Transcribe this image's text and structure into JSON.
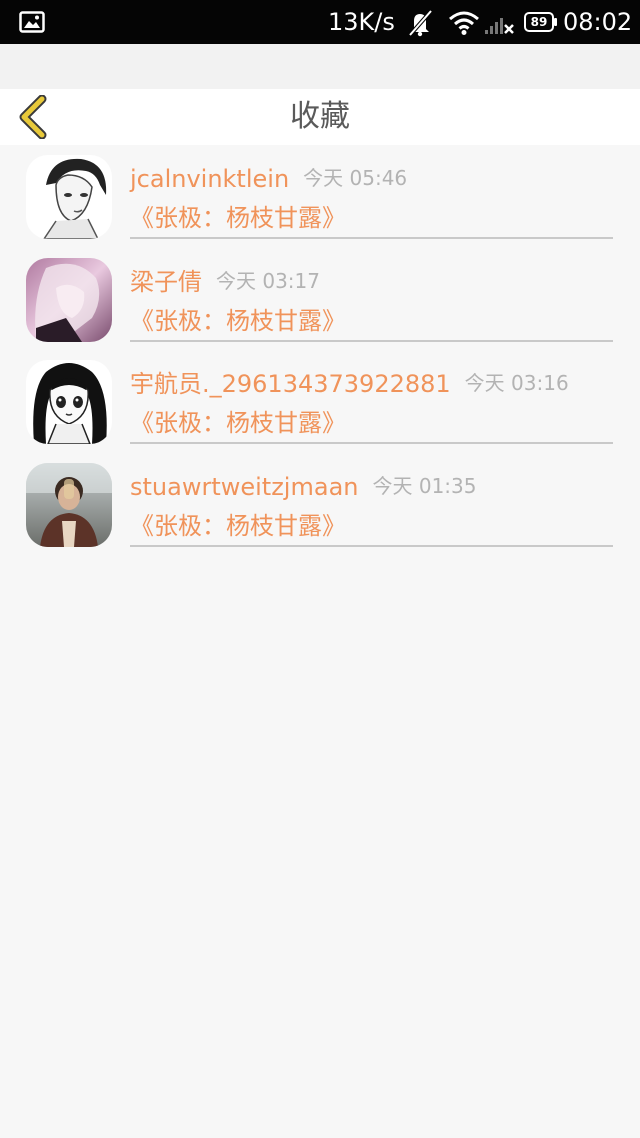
{
  "status_bar": {
    "net_speed": "13K/s",
    "battery": "89",
    "time": "08:02",
    "icons": [
      "gallery-icon",
      "bell-off-icon",
      "wifi-icon",
      "signal-icon",
      "battery-icon"
    ]
  },
  "header": {
    "title": "收藏",
    "back_icon": "chevron-left-icon"
  },
  "colors": {
    "accent": "#f0935a",
    "back_chevron": "#e8c93a",
    "timestamp": "#b3b3b3"
  },
  "favorites": [
    {
      "username": "jcalnvinktlein",
      "time": "今天 05:46",
      "title": "《张极：杨枝甘露》"
    },
    {
      "username": "梁子倩",
      "time": "今天 03:17",
      "title": "《张极：杨枝甘露》"
    },
    {
      "username": "宇航员._296134373922881",
      "time": "今天 03:16",
      "title": "《张极：杨枝甘露》"
    },
    {
      "username": "stuawrtweitzjmaan",
      "time": "今天 01:35",
      "title": "《张极：杨枝甘露》"
    }
  ]
}
